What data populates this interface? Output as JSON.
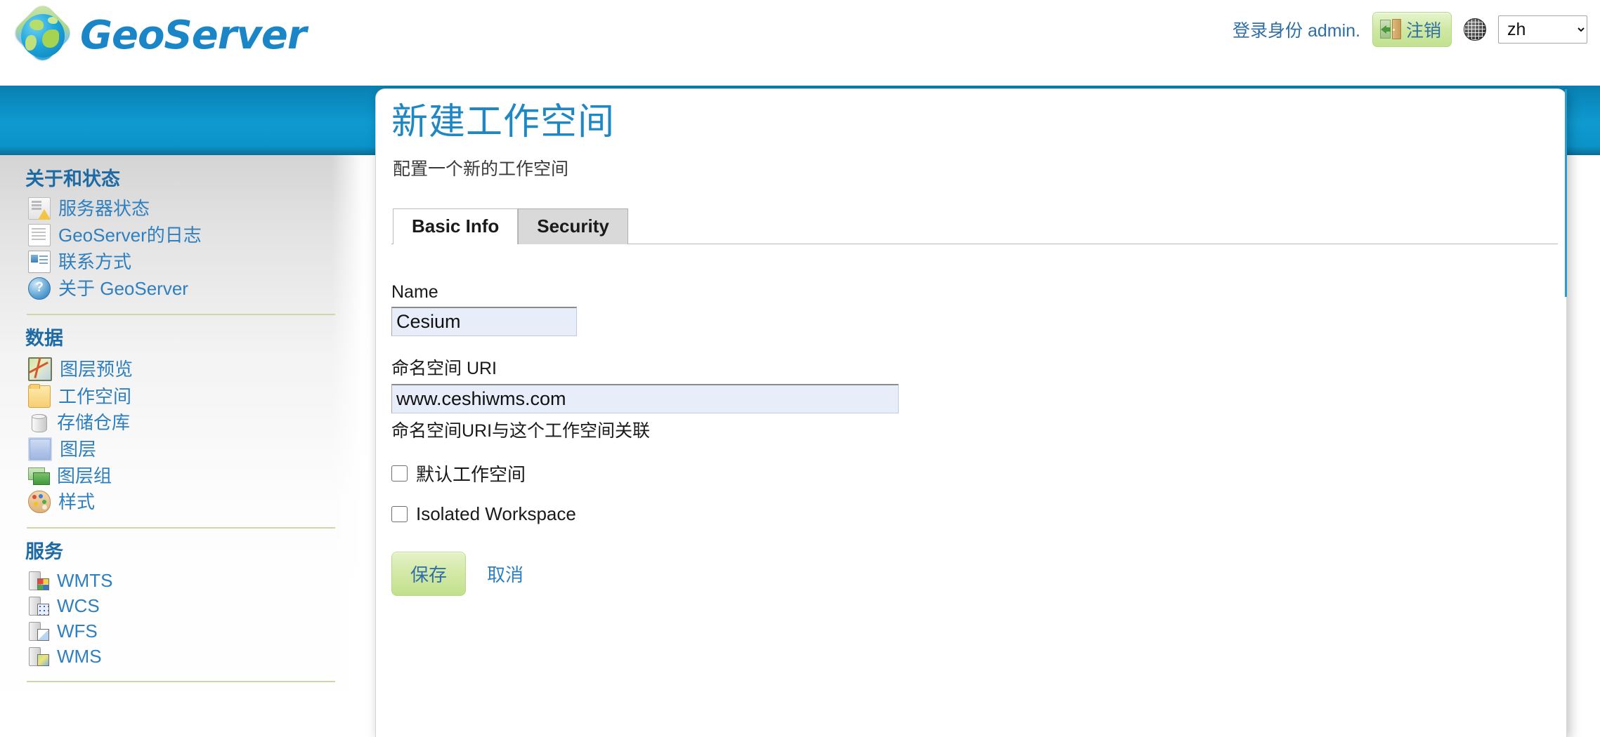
{
  "header": {
    "brand": "GeoServer",
    "login_status": "登录身份 admin.",
    "logout_label": "注销",
    "language_value": "zh",
    "language_options": [
      "zh"
    ]
  },
  "sidebar": {
    "groups": [
      {
        "title": "关于和状态",
        "items": [
          {
            "label": "服务器状态",
            "icon": "server-status-icon"
          },
          {
            "label": "GeoServer的日志",
            "icon": "log-document-icon"
          },
          {
            "label": "联系方式",
            "icon": "contact-card-icon"
          },
          {
            "label": "关于 GeoServer",
            "icon": "about-help-icon"
          }
        ]
      },
      {
        "title": "数据",
        "items": [
          {
            "label": "图层预览",
            "icon": "layer-preview-icon"
          },
          {
            "label": "工作空间",
            "icon": "folder-icon"
          },
          {
            "label": "存储仓库",
            "icon": "database-store-icon"
          },
          {
            "label": "图层",
            "icon": "layer-icon"
          },
          {
            "label": "图层组",
            "icon": "layer-group-icon"
          },
          {
            "label": "样式",
            "icon": "palette-style-icon"
          }
        ]
      },
      {
        "title": "服务",
        "items": [
          {
            "label": "WMTS",
            "icon": "service-wmts-icon"
          },
          {
            "label": "WCS",
            "icon": "service-wcs-icon"
          },
          {
            "label": "WFS",
            "icon": "service-wfs-icon"
          },
          {
            "label": "WMS",
            "icon": "service-wms-icon"
          }
        ]
      }
    ]
  },
  "main": {
    "title": "新建工作空间",
    "subtitle": "配置一个新的工作空间",
    "tabs": [
      {
        "label": "Basic Info",
        "active": true
      },
      {
        "label": "Security",
        "active": false
      }
    ],
    "form": {
      "name_label": "Name",
      "name_value": "Cesium",
      "name_placeholder": "",
      "uri_label": "命名空间 URI",
      "uri_value": "www.ceshiwms.com",
      "uri_placeholder": "",
      "uri_helper": "命名空间URI与这个工作空间关联",
      "default_workspace_label": "默认工作空间",
      "default_workspace_checked": false,
      "isolated_workspace_label": "Isolated Workspace",
      "isolated_workspace_checked": false,
      "save_label": "保存",
      "cancel_label": "取消"
    }
  },
  "colors": {
    "brand_blue": "#1a86c8",
    "band_blue": "#0e9ad0",
    "link_blue": "#2f7fbf",
    "heading_blue": "#1d6aa5",
    "accent_green": "#c2e08c",
    "divider_green": "#c9d9a8",
    "input_bg": "#e8edfa"
  }
}
